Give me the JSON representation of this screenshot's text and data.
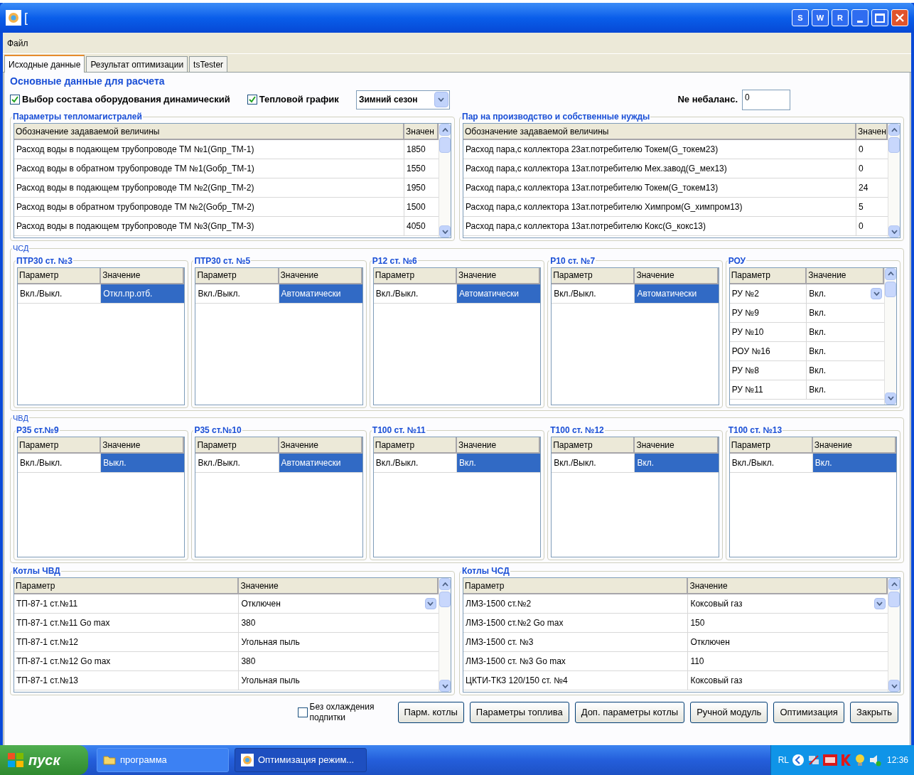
{
  "window": {
    "title": "[",
    "title_buttons": [
      "S",
      "W",
      "R"
    ]
  },
  "menu": [
    "Файл"
  ],
  "tabs": [
    {
      "label": "Исходные данные",
      "selected": true
    },
    {
      "label": "Результат оптимизации",
      "selected": false
    },
    {
      "label": "tsTester",
      "selected": false
    }
  ],
  "main": {
    "title": "Основные данные для расчета",
    "options": [
      {
        "label": "Выбор состава оборудования динамический",
        "checked": true
      },
      {
        "label": "Тепловой график",
        "checked": true
      }
    ],
    "season": {
      "value": "Зимний сезон"
    },
    "imbalance": {
      "label": "Ne небаланс.",
      "value": "0"
    }
  },
  "tables": [
    {
      "title": "Параметры тепломагистралей",
      "columns": [
        "Обозначение задаваемой величины",
        "Значен"
      ],
      "rows": [
        {
          "name": "Расход воды в подающем трубопроводе ТМ №1(Gпр_ТМ-1)",
          "value": "1850"
        },
        {
          "name": "Расход воды в обратном трубопроводе ТМ №1(Gобр_ТМ-1)",
          "value": "1550"
        },
        {
          "name": "Расход воды в подающем трубопроводе ТМ №2(Gпр_ТМ-2)",
          "value": "1950"
        },
        {
          "name": "Расход воды в обратном трубопроводе ТМ №2(Gобр_ТМ-2)",
          "value": "1500"
        },
        {
          "name": "Расход воды в подающем трубопроводе ТМ №3(Gпр_ТМ-3)",
          "value": "4050"
        }
      ]
    },
    {
      "title": "Пар на производство и собственные нужды",
      "columns": [
        "Обозначение задаваемой величины",
        "Значен"
      ],
      "rows": [
        {
          "name": "Расход пара,с коллектора 23ат.потребителю Токем(G_токем23)",
          "value": "0"
        },
        {
          "name": "Расход пара,с коллектора 13ат.потребителю Мех.завод(G_мех13)",
          "value": "0"
        },
        {
          "name": "Расход пара,с коллектора 13ат.потребителю Токем(G_токем13)",
          "value": "24"
        },
        {
          "name": "Расход пара,с коллектора 13ат.потребителю Химпром(G_химпром13)",
          "value": "5"
        },
        {
          "name": "Расход пара,с коллектора 13ат.потребителю Кокс(G_кокс13)",
          "value": "0"
        }
      ]
    }
  ],
  "groups": [
    {
      "title": "ЧСД",
      "panels": [
        {
          "title": "ПТР30 ст. №3",
          "scrollbar": false,
          "columns": [
            "Параметр",
            "Значение"
          ],
          "rows": [
            {
              "name": "Вкл./Выкл.",
              "value": "Откл.пр.отб.",
              "selected": true,
              "kind": "text"
            }
          ]
        },
        {
          "title": "ПТР30 ст. №5",
          "scrollbar": false,
          "columns": [
            "Параметр",
            "Значение"
          ],
          "rows": [
            {
              "name": "Вкл./Выкл.",
              "value": "Автоматически",
              "selected": true,
              "kind": "text"
            }
          ]
        },
        {
          "title": "Р12 ст. №6",
          "scrollbar": false,
          "columns": [
            "Параметр",
            "Значение"
          ],
          "rows": [
            {
              "name": "Вкл./Выкл.",
              "value": "Автоматически",
              "selected": true,
              "kind": "text"
            }
          ]
        },
        {
          "title": "Р10 ст. №7",
          "scrollbar": false,
          "columns": [
            "Параметр",
            "Значение"
          ],
          "rows": [
            {
              "name": "Вкл./Выкл.",
              "value": "Автоматически",
              "selected": true,
              "kind": "text"
            }
          ]
        },
        {
          "title": "РОУ",
          "scrollbar": true,
          "columns": [
            "Параметр",
            "Значение"
          ],
          "rows": [
            {
              "name": "РУ №2",
              "value": "Вкл.",
              "selected": false,
              "kind": "dropdown"
            },
            {
              "name": "РУ №9",
              "value": "Вкл.",
              "selected": false,
              "kind": "text"
            },
            {
              "name": "РУ №10",
              "value": "Вкл.",
              "selected": false,
              "kind": "text"
            },
            {
              "name": "РОУ №16",
              "value": "Вкл.",
              "selected": false,
              "kind": "text"
            },
            {
              "name": "РУ №8",
              "value": "Вкл.",
              "selected": false,
              "kind": "text"
            },
            {
              "name": "РУ №11",
              "value": "Вкл.",
              "selected": false,
              "kind": "text"
            }
          ]
        }
      ]
    },
    {
      "title": "ЧВД",
      "panels": [
        {
          "title": "Р35 ст.№9",
          "scrollbar": false,
          "columns": [
            "Параметр",
            "Значение"
          ],
          "rows": [
            {
              "name": "Вкл./Выкл.",
              "value": "Выкл.",
              "selected": true,
              "kind": "text"
            }
          ]
        },
        {
          "title": "Р35 ст.№10",
          "scrollbar": false,
          "columns": [
            "Параметр",
            "Значение"
          ],
          "rows": [
            {
              "name": "Вкл./Выкл.",
              "value": "Автоматически",
              "selected": true,
              "kind": "text"
            }
          ]
        },
        {
          "title": "Т100 ст. №11",
          "scrollbar": false,
          "columns": [
            "Параметр",
            "Значение"
          ],
          "rows": [
            {
              "name": "Вкл./Выкл.",
              "value": "Вкл.",
              "selected": true,
              "kind": "text"
            }
          ]
        },
        {
          "title": "Т100 ст. №12",
          "scrollbar": false,
          "columns": [
            "Параметр",
            "Значение"
          ],
          "rows": [
            {
              "name": "Вкл./Выкл.",
              "value": "Вкл.",
              "selected": true,
              "kind": "text"
            }
          ]
        },
        {
          "title": "Т100 ст. №13",
          "scrollbar": false,
          "columns": [
            "Параметр",
            "Значение"
          ],
          "rows": [
            {
              "name": "Вкл./Выкл.",
              "value": "Вкл.",
              "selected": true,
              "kind": "text"
            }
          ]
        }
      ]
    }
  ],
  "boilers": [
    {
      "title": "Котлы ЧВД",
      "columns": [
        "Параметр",
        "Значение"
      ],
      "rows": [
        {
          "name": "ТП-87-1 ст.№11",
          "value": "Отключен",
          "kind": "dropdown"
        },
        {
          "name": "ТП-87-1 ст.№11 Go max",
          "value": "380",
          "kind": "text"
        },
        {
          "name": "ТП-87-1 ст.№12",
          "value": "Угольная пыль",
          "kind": "text"
        },
        {
          "name": "ТП-87-1 ст.№12 Go max",
          "value": "380",
          "kind": "text"
        },
        {
          "name": "ТП-87-1 ст.№13",
          "value": "Угольная пыль",
          "kind": "text"
        }
      ]
    },
    {
      "title": "Котлы ЧСД",
      "columns": [
        "Параметр",
        "Значение"
      ],
      "rows": [
        {
          "name": "ЛМЗ-1500 ст.№2",
          "value": "Коксовый газ",
          "kind": "dropdown"
        },
        {
          "name": "ЛМЗ-1500 ст.№2 Go max",
          "value": "150",
          "kind": "text"
        },
        {
          "name": "ЛМЗ-1500 ст. №3",
          "value": "Отключен",
          "kind": "text"
        },
        {
          "name": "ЛМЗ-1500 ст. №3 Go max",
          "value": "110",
          "kind": "text"
        },
        {
          "name": "ЦКТИ-ТКЗ 120/150 ст. №4",
          "value": "Коксовый газ",
          "kind": "text"
        }
      ]
    }
  ],
  "bottom": {
    "checkbox": {
      "label": "Без охлаждения подпитки",
      "checked": false
    },
    "buttons": [
      "Парм. котлы",
      "Параметры топлива",
      "Доп. параметры котлы",
      "Ручной модуль",
      "Оптимизация",
      "Закрыть"
    ]
  },
  "taskbar": {
    "start": "пуск",
    "items": [
      {
        "label": "программа",
        "selected": false
      },
      {
        "label": "Оптимизация режим...",
        "selected": true
      }
    ],
    "tray": {
      "language": "RL",
      "time": "12:36"
    }
  }
}
